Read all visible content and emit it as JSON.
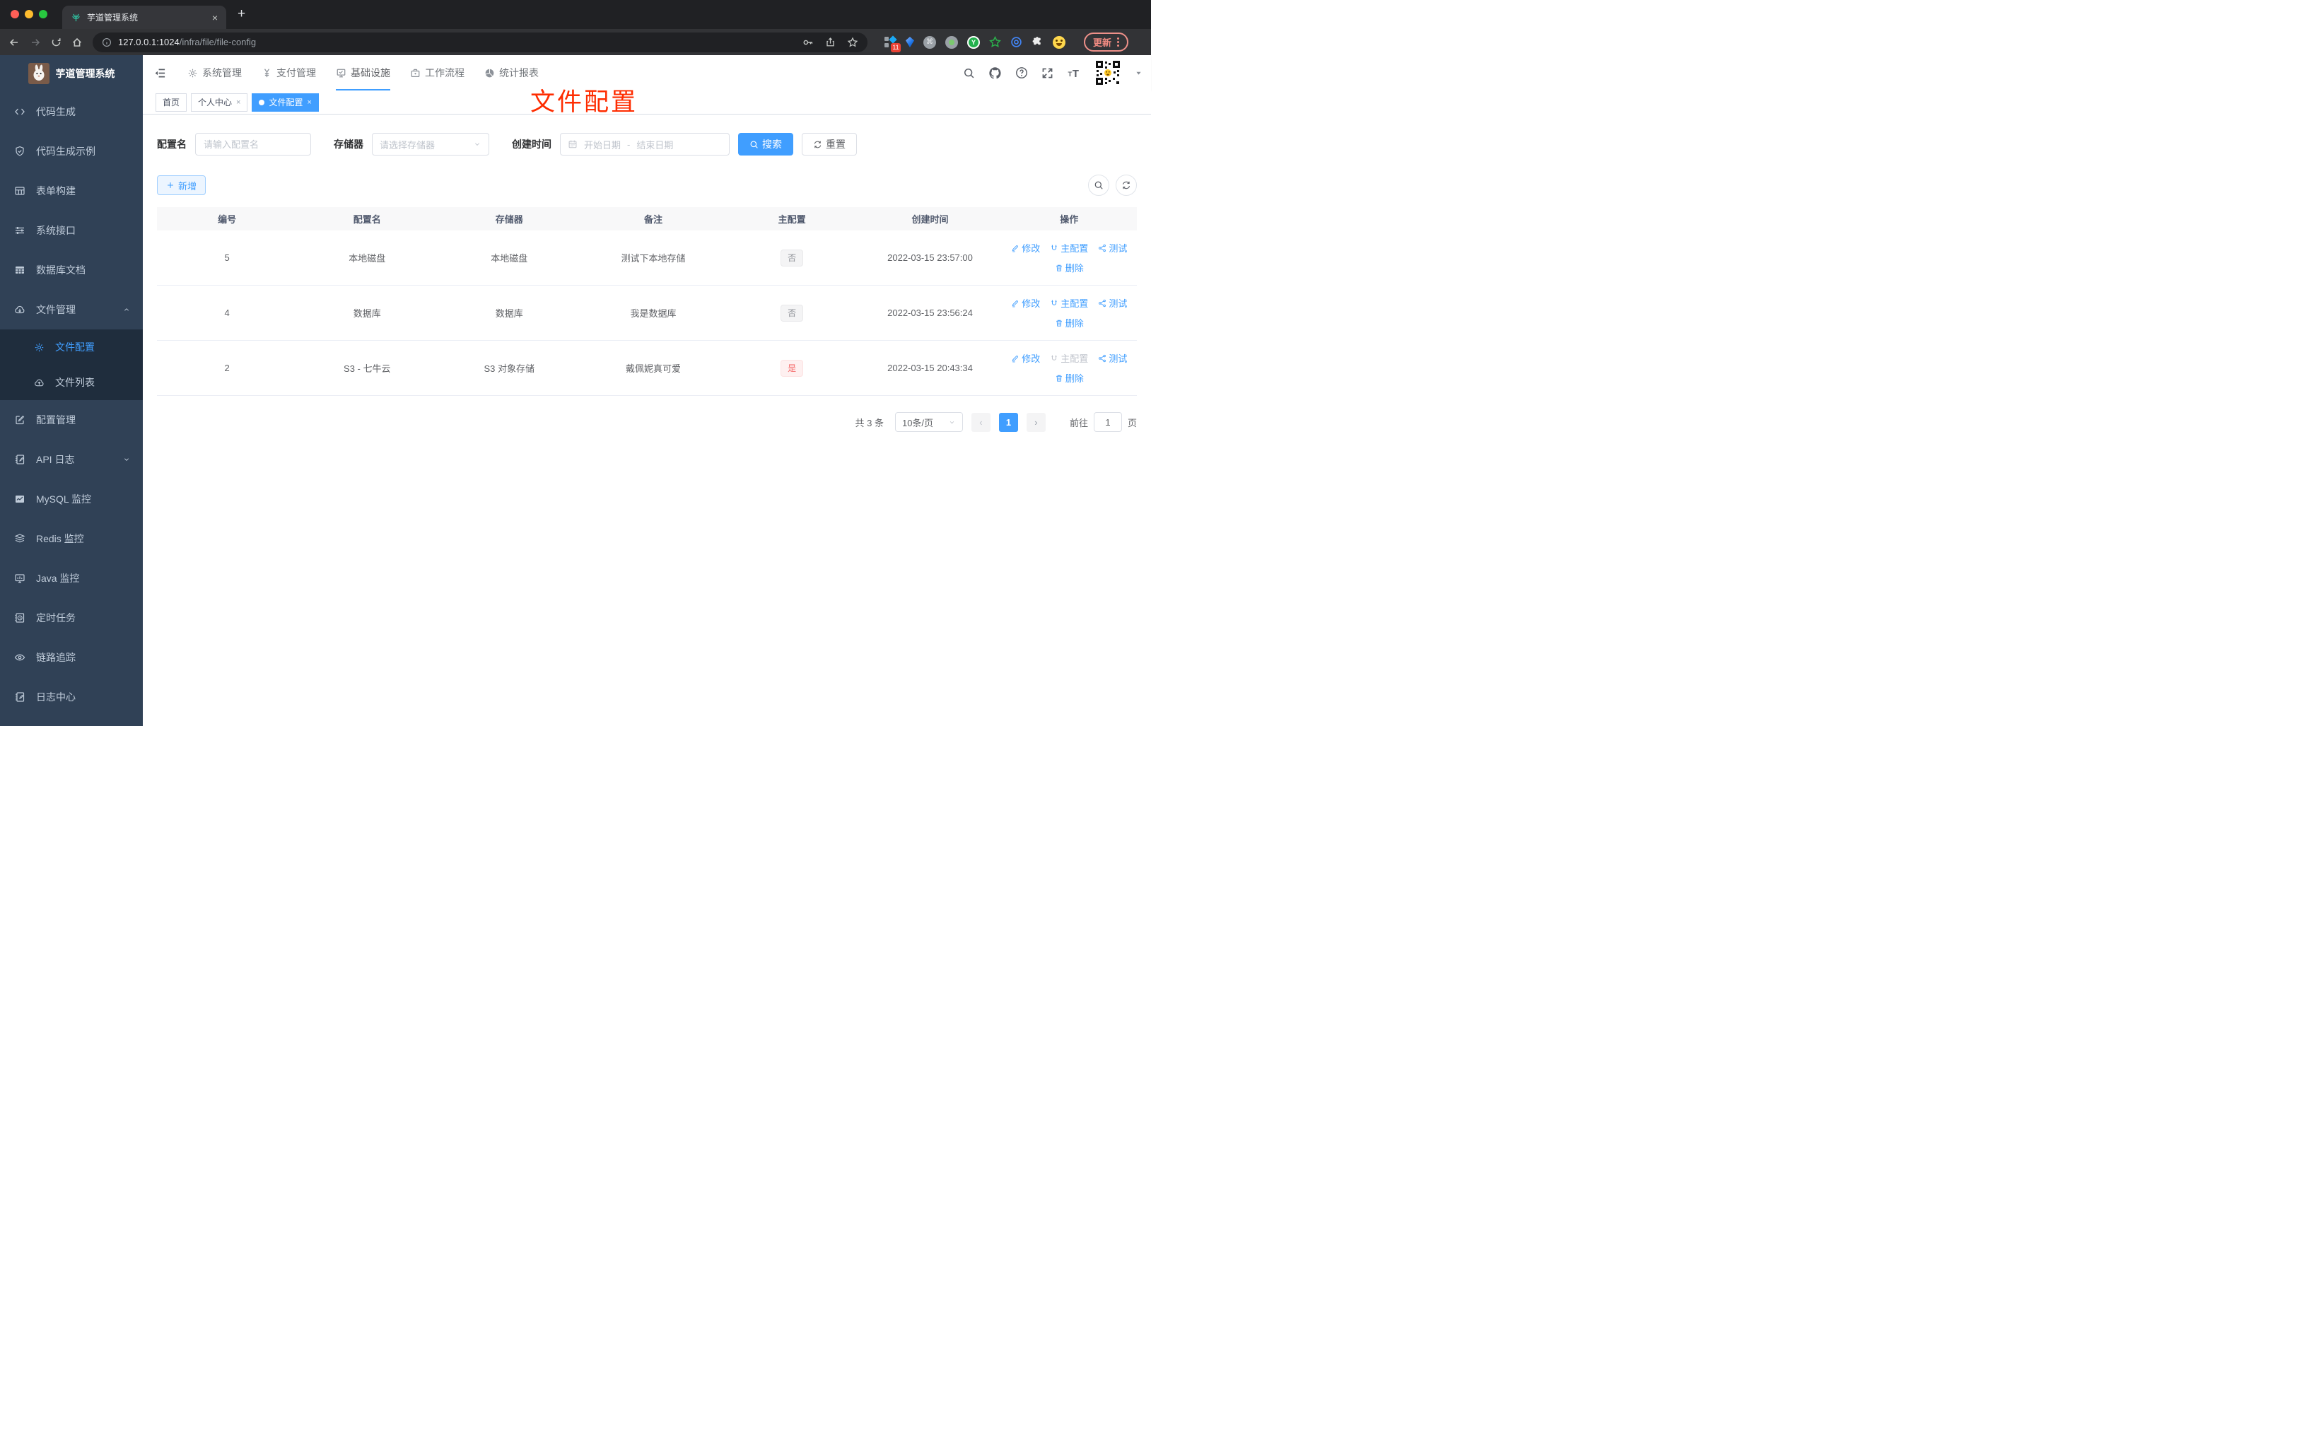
{
  "colors": {
    "accent": "#409eff",
    "annotation_red": "#fe2c00",
    "sidebar_bg": "#304156",
    "submenu_bg": "#1f2d3d",
    "tag_info_text": "#909399",
    "tag_danger_text": "#f56c6c"
  },
  "browser": {
    "tab_title": "芋道管理系统",
    "tab_close": "×",
    "new_tab": "+",
    "url_host": "127.0.0.1:1024",
    "url_path": "/infra/file/file-config",
    "extensions_badge": "11",
    "update_button": "更新"
  },
  "sidebar": {
    "logo_title": "芋道管理系统",
    "items": [
      {
        "label": "代码生成",
        "icon": "code-icon"
      },
      {
        "label": "代码生成示例",
        "icon": "shield-check-icon"
      },
      {
        "label": "表单构建",
        "icon": "form-table-icon"
      },
      {
        "label": "系统接口",
        "icon": "sliders-icon"
      },
      {
        "label": "数据库文档",
        "icon": "database-table-icon"
      },
      {
        "label": "文件管理",
        "icon": "cloud-download-icon",
        "expanded": true,
        "children": [
          {
            "label": "文件配置",
            "icon": "gear-icon",
            "active": true
          },
          {
            "label": "文件列表",
            "icon": "cloud-upload-icon"
          }
        ]
      },
      {
        "label": "配置管理",
        "icon": "edit-square-icon"
      },
      {
        "label": "API 日志",
        "icon": "log-edit-icon",
        "collapsed": true
      },
      {
        "label": "MySQL 监控",
        "icon": "mysql-monitor-icon"
      },
      {
        "label": "Redis 监控",
        "icon": "redis-layers-icon"
      },
      {
        "label": "Java 监控",
        "icon": "java-monitor-icon"
      },
      {
        "label": "定时任务",
        "icon": "schedule-icon"
      },
      {
        "label": "链路追踪",
        "icon": "trace-eye-icon"
      },
      {
        "label": "日志中心",
        "icon": "log-center-icon"
      }
    ]
  },
  "topnav": {
    "items": [
      {
        "label": "系统管理",
        "icon": "gear-icon"
      },
      {
        "label": "支付管理",
        "icon": "yen-icon"
      },
      {
        "label": "基础设施",
        "icon": "infrastructure-icon",
        "active": true
      },
      {
        "label": "工作流程",
        "icon": "workflow-icon"
      },
      {
        "label": "统计报表",
        "icon": "report-icon"
      }
    ]
  },
  "tabs": [
    {
      "label": "首页"
    },
    {
      "label": "个人中心",
      "closable": true
    },
    {
      "label": "文件配置",
      "closable": true,
      "active": true
    }
  ],
  "annotation": {
    "text": "文件配置"
  },
  "filters": {
    "config_name_label": "配置名",
    "config_name_placeholder": "请输入配置名",
    "storage_label": "存储器",
    "storage_placeholder": "请选择存储器",
    "create_time_label": "创建时间",
    "date_start_placeholder": "开始日期",
    "date_separator": "-",
    "date_end_placeholder": "结束日期",
    "search_button": "搜索",
    "reset_button": "重置"
  },
  "toolbar": {
    "add_button": "新增"
  },
  "table": {
    "columns": [
      "编号",
      "配置名",
      "存储器",
      "备注",
      "主配置",
      "创建时间",
      "操作"
    ],
    "actions": {
      "edit": "修改",
      "master": "主配置",
      "test": "测试",
      "delete": "删除"
    },
    "rows": [
      {
        "id": "5",
        "name": "本地磁盘",
        "storage": "本地磁盘",
        "remark": "测试下本地存储",
        "master": "否",
        "master_state": "info",
        "created": "2022-03-15 23:57:00",
        "master_action_disabled": false
      },
      {
        "id": "4",
        "name": "数据库",
        "storage": "数据库",
        "remark": "我是数据库",
        "master": "否",
        "master_state": "info",
        "created": "2022-03-15 23:56:24",
        "master_action_disabled": false
      },
      {
        "id": "2",
        "name": "S3 - 七牛云",
        "storage": "S3 对象存储",
        "remark": "戴佩妮真可爱",
        "master": "是",
        "master_state": "danger",
        "created": "2022-03-15 20:43:34",
        "master_action_disabled": true
      }
    ]
  },
  "pagination": {
    "total": "共 3 条",
    "page_size": "10条/页",
    "current_page": "1",
    "goto_label": "前往",
    "goto_value": "1",
    "page_unit": "页"
  }
}
